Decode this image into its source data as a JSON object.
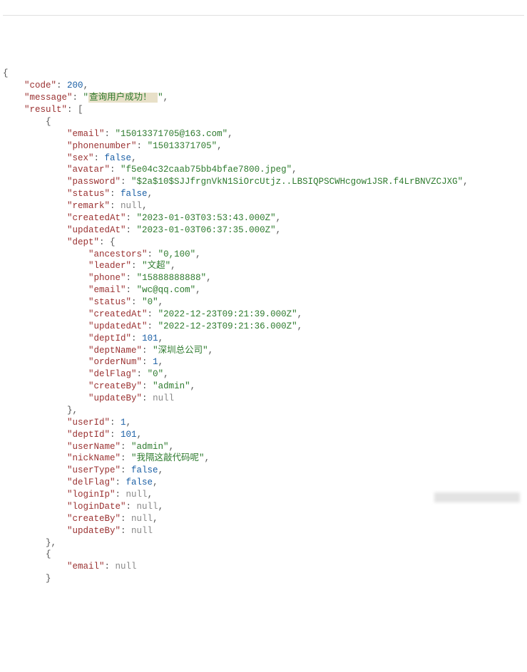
{
  "response": {
    "code": 200,
    "message": "查询用户成功！ ",
    "result": [
      {
        "email": "15013371705@163.com",
        "phonenumber": "15013371705",
        "sex": false,
        "avatar": "f5e04c32caab75bb4bfae7800.jpeg",
        "password": "$2a$10$SJJfrgnVkN1SiOrcUtjz..LBSIQPSCWHcgow1JSR.f4LrBNVZCJXG",
        "status": false,
        "remark": null,
        "createdAt": "2023-01-03T03:53:43.000Z",
        "updatedAt": "2023-01-03T06:37:35.000Z",
        "dept": {
          "ancestors": "0,100",
          "leader": "文超",
          "phone": "15888888888",
          "email": "wc@qq.com",
          "status": "0",
          "createdAt": "2022-12-23T09:21:39.000Z",
          "updatedAt": "2022-12-23T09:21:36.000Z",
          "deptId": 101,
          "deptName": "深圳总公司",
          "orderNum": 1,
          "delFlag": "0",
          "createBy": "admin",
          "updateBy": null
        },
        "userId": 1,
        "deptId": 101,
        "userName": "admin",
        "nickName": "我隔这敲代码呢",
        "userType": false,
        "delFlag": false,
        "loginIp": null,
        "loginDate": null,
        "createBy": null,
        "updateBy": null
      },
      {
        "email": null
      }
    ]
  },
  "highlight_path": "response.message"
}
